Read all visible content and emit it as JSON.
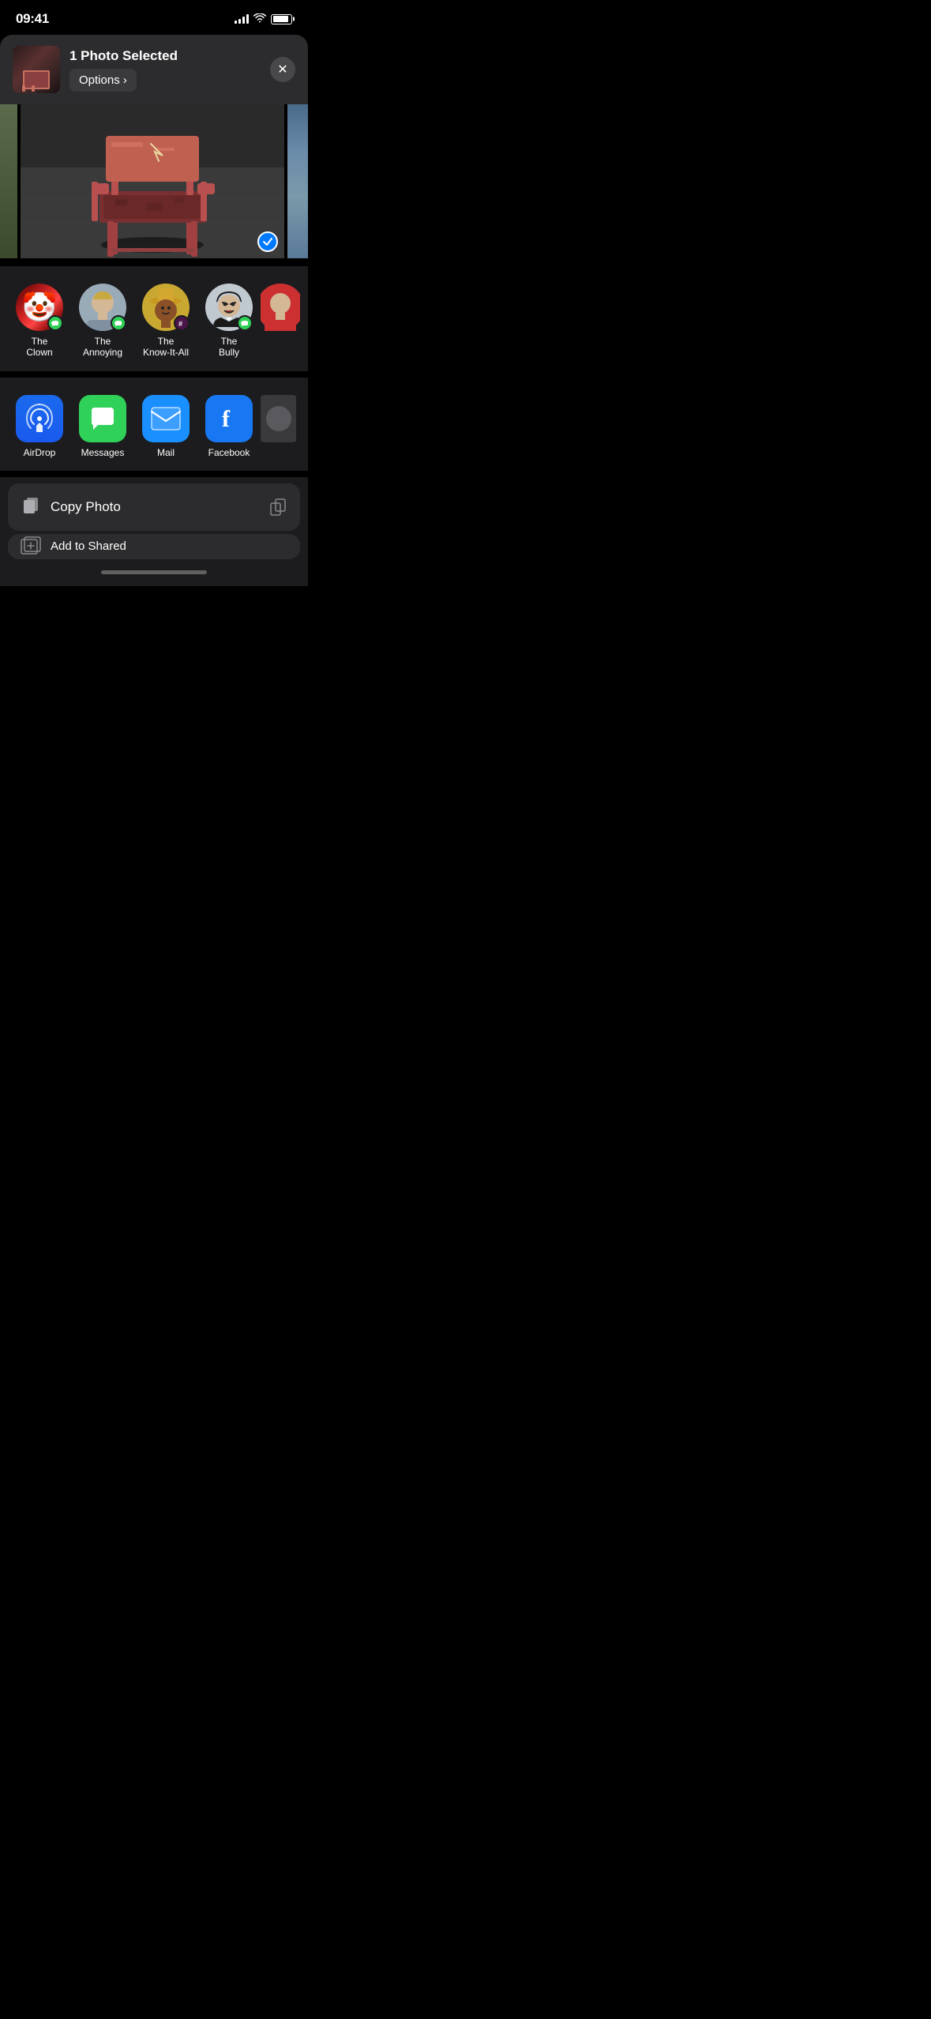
{
  "statusBar": {
    "time": "09:41",
    "locationIcon": "▶",
    "batteryLevel": 90
  },
  "shareHeader": {
    "selectedText": "1 Photo Selected",
    "optionsLabel": "Options",
    "optionsChevron": "›",
    "closeButton": "×"
  },
  "contacts": [
    {
      "id": "clown",
      "name": "The\nClown",
      "avatarType": "clown",
      "badge": "messages"
    },
    {
      "id": "annoying",
      "name": "The\nAnnoying",
      "avatarType": "annoying",
      "badge": "messages"
    },
    {
      "id": "knowitall",
      "name": "The\nKnow-It-All",
      "avatarType": "knowitall",
      "badge": "slack"
    },
    {
      "id": "bully",
      "name": "The\nBully",
      "avatarType": "bully",
      "badge": "messages"
    },
    {
      "id": "partial",
      "name": "",
      "avatarType": "partial",
      "badge": null
    }
  ],
  "apps": [
    {
      "id": "airdrop",
      "name": "AirDrop",
      "iconType": "airdrop"
    },
    {
      "id": "messages",
      "name": "Messages",
      "iconType": "messages"
    },
    {
      "id": "mail",
      "name": "Mail",
      "iconType": "mail"
    },
    {
      "id": "facebook",
      "name": "Facebook",
      "iconType": "facebook"
    },
    {
      "id": "more",
      "name": "",
      "iconType": "more"
    }
  ],
  "actions": [
    {
      "id": "copy-photo",
      "label": "Copy Photo",
      "icon": "📋"
    },
    {
      "id": "add-shared-album",
      "label": "Add to Shared Album",
      "icon": "📚"
    }
  ],
  "contactNames": {
    "clown": "The\nClown",
    "annoying": "The\nAnnoying",
    "knowitall": "The\nKnow-It-All",
    "bully": "The\nBully"
  },
  "appNames": {
    "airdrop": "AirDrop",
    "messages": "Messages",
    "mail": "Mail",
    "facebook": "Facebook"
  },
  "actionLabels": {
    "copyPhoto": "Copy Photo",
    "addSharedAlbum": "Add to Shared Album"
  }
}
